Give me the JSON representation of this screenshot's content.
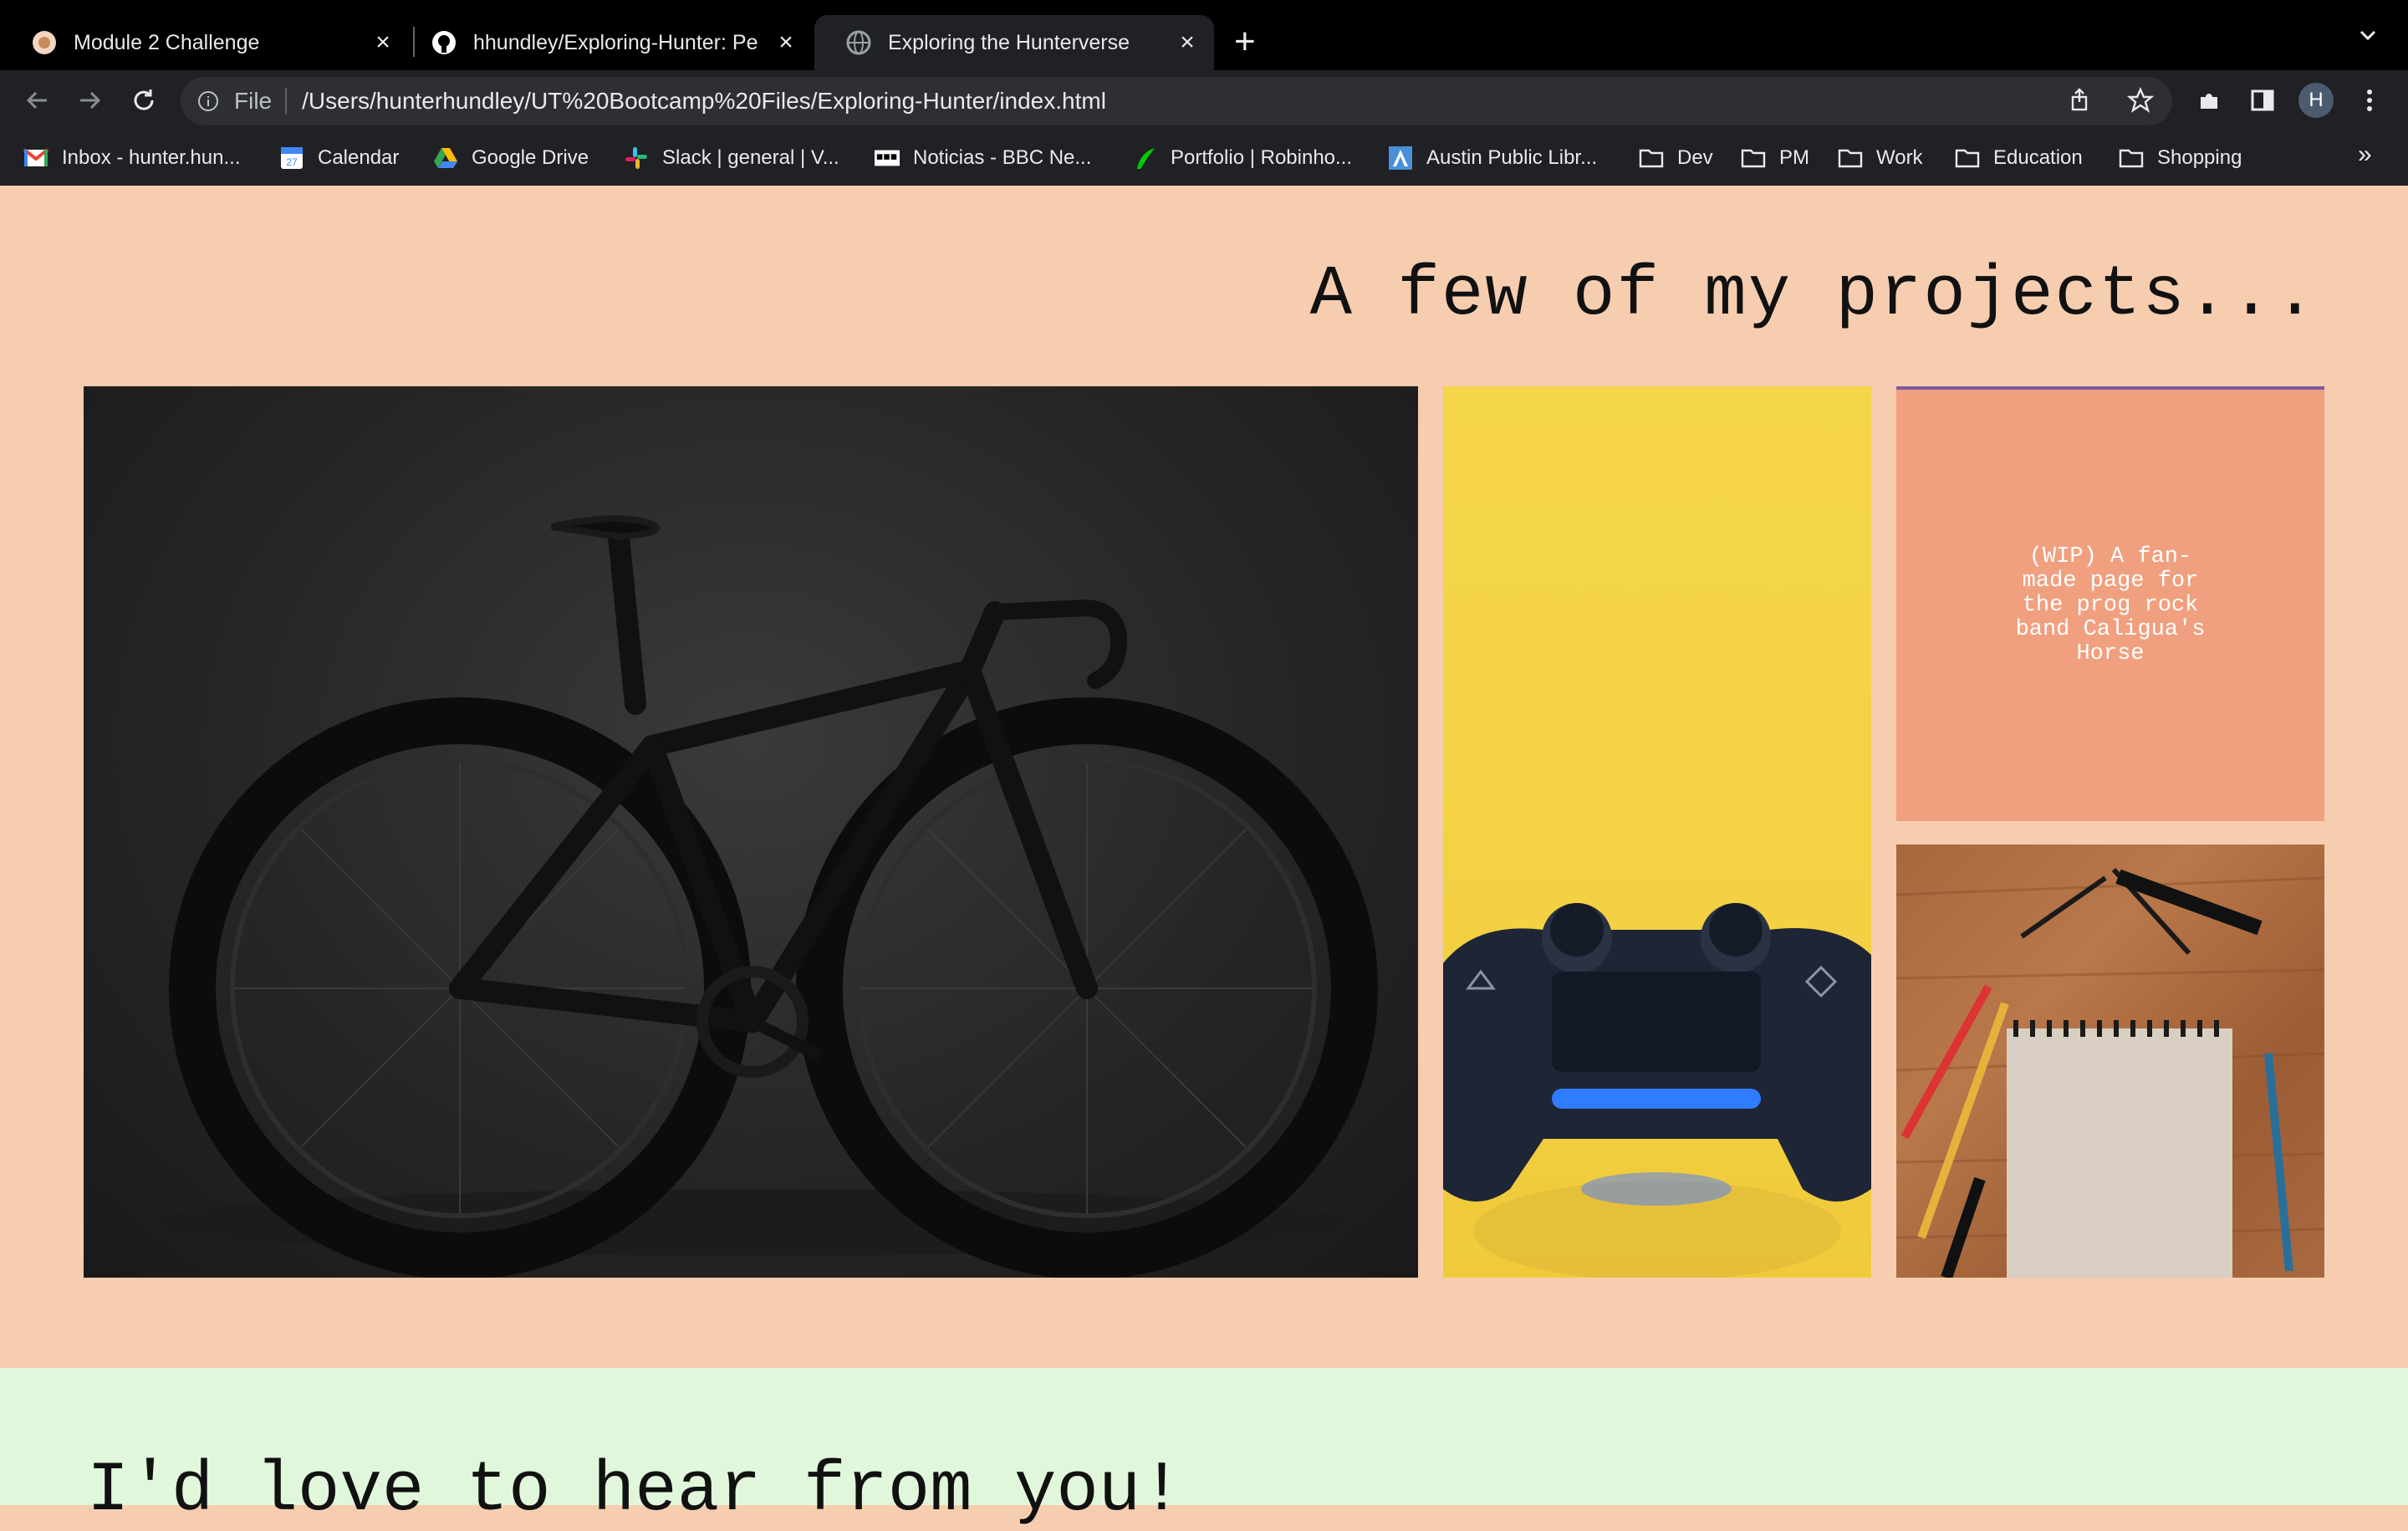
{
  "browser": {
    "tabs": [
      {
        "title": "Module 2 Challenge",
        "favicon": "module-favicon",
        "active": false
      },
      {
        "title": "hhundley/Exploring-Hunter: Pe",
        "favicon": "github-icon",
        "active": false
      },
      {
        "title": "Exploring the Hunterverse",
        "favicon": "globe-icon",
        "active": true
      }
    ],
    "new_tab_label": "+",
    "omnibox": {
      "scheme_label": "File",
      "url": "/Users/hunterhundley/UT%20Bootcamp%20Files/Exploring-Hunter/index.html"
    },
    "profile_initial": "H",
    "bookmarks": [
      {
        "label": "Inbox - hunter.hun...",
        "icon": "gmail-icon"
      },
      {
        "label": "Calendar",
        "icon": "calendar-icon"
      },
      {
        "label": "Google Drive",
        "icon": "drive-icon"
      },
      {
        "label": "Slack | general | V...",
        "icon": "slack-icon"
      },
      {
        "label": "Noticias - BBC Ne...",
        "icon": "bbc-icon"
      },
      {
        "label": "Portfolio | Robinho...",
        "icon": "robinhood-icon"
      },
      {
        "label": "Austin Public Libr...",
        "icon": "library-icon"
      },
      {
        "label": "Dev",
        "icon": "folder-icon"
      },
      {
        "label": "PM",
        "icon": "folder-icon"
      },
      {
        "label": "Work",
        "icon": "folder-icon"
      },
      {
        "label": "Education",
        "icon": "folder-icon"
      },
      {
        "label": "Shopping",
        "icon": "folder-icon"
      }
    ],
    "bookmarks_overflow": "»"
  },
  "page": {
    "projects_title": "A few of my projects...",
    "projects": [
      {
        "image": "road-bike-photo",
        "caption": ""
      },
      {
        "image": "game-controller-photo",
        "caption": ""
      },
      {
        "image": "",
        "caption": "(WIP) A fan-made page for the prog rock band Caligua's Horse"
      },
      {
        "image": "sketchbook-desk-photo",
        "caption": ""
      }
    ],
    "contact_title": "I'd love to hear from you!"
  },
  "colors": {
    "projects_bg": "#f7cdb0",
    "contact_bg": "#e0f7db",
    "wip_card_bg": "#f0a07f",
    "chrome_dark": "#202124"
  }
}
